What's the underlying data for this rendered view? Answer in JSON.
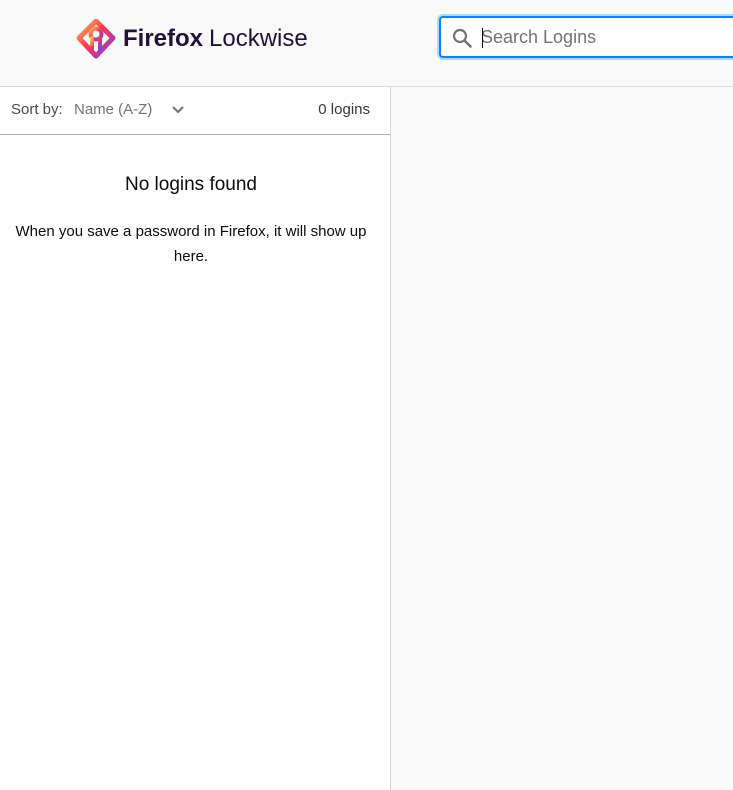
{
  "header": {
    "brand_name_bold": "Firefox",
    "brand_name_light": "Lockwise",
    "logo_icon": "lockwise-logo-icon"
  },
  "search": {
    "placeholder": "Search Logins",
    "value": "",
    "icon": "search-icon"
  },
  "sort": {
    "label": "Sort by:",
    "selected": "Name (A-Z)",
    "icon": "chevron-down-icon"
  },
  "list": {
    "count_text": "0 logins"
  },
  "empty_state": {
    "title": "No logins found",
    "description": "When you save a password in Firefox, it will show up here."
  },
  "colors": {
    "focus_ring": "#0a84ff",
    "brand_text": "#20123a",
    "panel_bg": "#f9f9fa"
  }
}
